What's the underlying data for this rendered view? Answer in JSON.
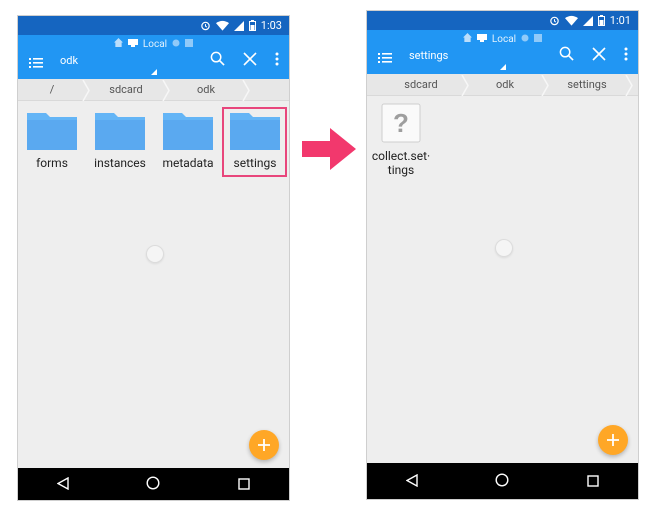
{
  "left": {
    "status": {
      "time": "1:03"
    },
    "appbar": {
      "location": "Local",
      "title": "odk"
    },
    "breadcrumb": [
      "/",
      "sdcard",
      "odk"
    ],
    "files": [
      {
        "name": "forms"
      },
      {
        "name": "instances"
      },
      {
        "name": "metadata"
      },
      {
        "name": "settings"
      }
    ]
  },
  "right": {
    "status": {
      "time": "1:01"
    },
    "appbar": {
      "location": "Local",
      "title": "settings"
    },
    "breadcrumb": [
      "sdcard",
      "odk",
      "settings"
    ],
    "files": [
      {
        "name": "collect.settings",
        "name_line1": "collect.set·",
        "name_line2": "tings"
      }
    ]
  },
  "colors": {
    "status_bar": "#1565c0",
    "app_bar": "#2196f3",
    "folder": "#64b5f6",
    "highlight": "#e8467c",
    "fab": "#ffa726",
    "arrow": "#f2386d"
  },
  "icons": [
    "alarm-icon",
    "wifi-icon",
    "signal-icon",
    "battery-icon",
    "home-icon",
    "local-storage-icon",
    "menu-icon",
    "search-icon",
    "close-icon",
    "overflow-icon",
    "folder-icon",
    "unknown-file-icon",
    "add-icon",
    "back-icon",
    "home-button-icon",
    "recents-icon",
    "arrow-right-icon"
  ]
}
